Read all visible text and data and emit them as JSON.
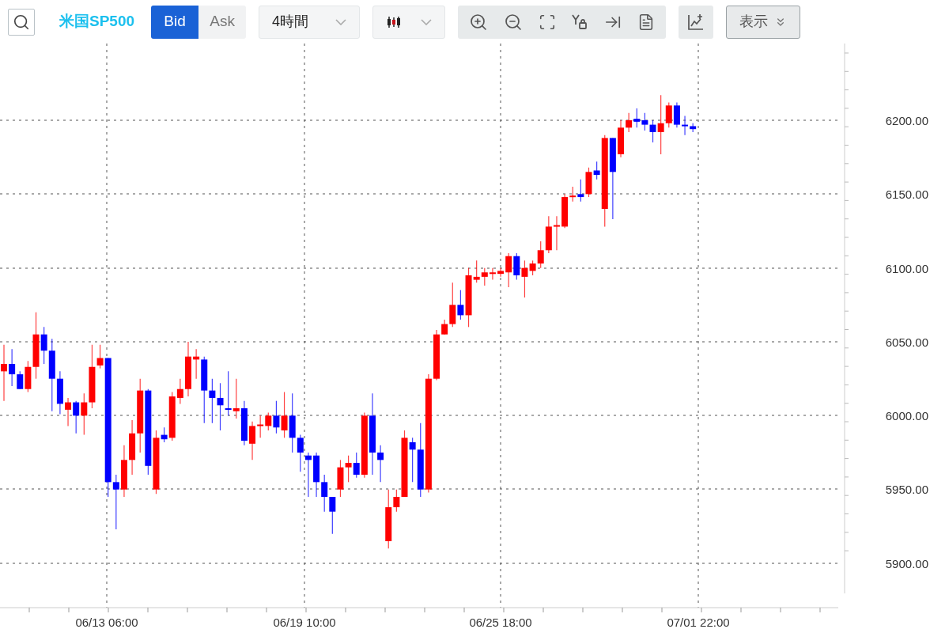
{
  "toolbar": {
    "symbol": "米国SP500",
    "price_tabs": [
      {
        "label": "Bid",
        "selected": true
      },
      {
        "label": "Ask",
        "selected": false
      }
    ],
    "timeframe": "4時間",
    "display_menu": "表示"
  },
  "chart": {
    "price_labels": [
      "6200.00",
      "6150.00",
      "6100.00",
      "6050.00",
      "6000.00",
      "5950.00",
      "5900.00"
    ],
    "time_labels": [
      "06/13 06:00",
      "06/19 10:00",
      "06/25 18:00",
      "07/01 22:00"
    ]
  }
}
